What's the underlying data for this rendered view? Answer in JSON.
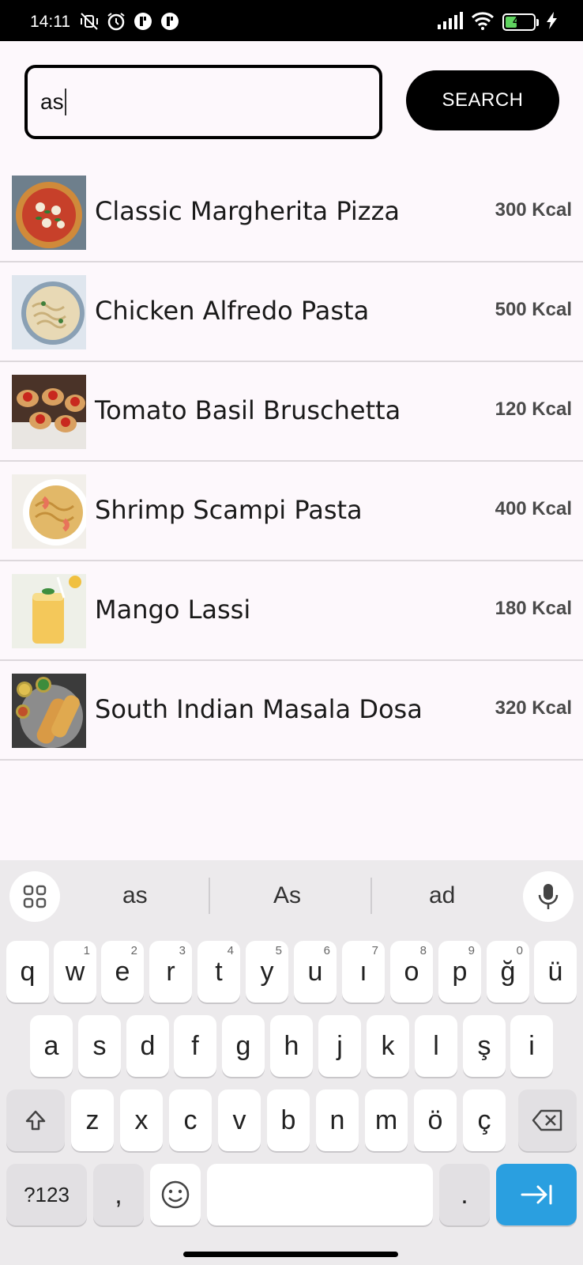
{
  "status_bar": {
    "time": "14:11",
    "battery": "40",
    "left_icons": [
      "mute-vibrate-icon",
      "alarm-icon",
      "app-notification-icon",
      "app-notification-icon"
    ],
    "right_icons": [
      "signal-icon",
      "wifi-icon",
      "battery-icon",
      "charging-icon"
    ]
  },
  "search": {
    "value": "as",
    "button_label": "SEARCH"
  },
  "foods": [
    {
      "name": "Classic Margherita Pizza",
      "kcal": "300 Kcal",
      "thumb": "pizza-photo"
    },
    {
      "name": "Chicken Alfredo Pasta",
      "kcal": "500 Kcal",
      "thumb": "pasta-photo"
    },
    {
      "name": "Tomato Basil Bruschetta",
      "kcal": "120 Kcal",
      "thumb": "bruschetta-photo"
    },
    {
      "name": "Shrimp Scampi Pasta",
      "kcal": "400 Kcal",
      "thumb": "shrimp-pasta-photo"
    },
    {
      "name": "Mango Lassi",
      "kcal": "180 Kcal",
      "thumb": "mango-lassi-photo"
    },
    {
      "name": "South Indian Masala Dosa",
      "kcal": "320 Kcal",
      "thumb": "dosa-photo"
    }
  ],
  "keyboard": {
    "suggestions": [
      "as",
      "As",
      "ad"
    ],
    "row1": [
      "q",
      "w",
      "e",
      "r",
      "t",
      "y",
      "u",
      "ı",
      "o",
      "p",
      "ğ",
      "ü"
    ],
    "row1_nums": [
      "",
      "1",
      "2",
      "3",
      "4",
      "5",
      "6",
      "7",
      "8",
      "9",
      "0",
      ""
    ],
    "row2": [
      "a",
      "s",
      "d",
      "f",
      "g",
      "h",
      "j",
      "k",
      "l",
      "ş",
      "i"
    ],
    "row3": [
      "z",
      "x",
      "c",
      "v",
      "b",
      "n",
      "m",
      "ö",
      "ç"
    ],
    "symbols_label": "?123",
    "comma": ",",
    "period": "."
  }
}
